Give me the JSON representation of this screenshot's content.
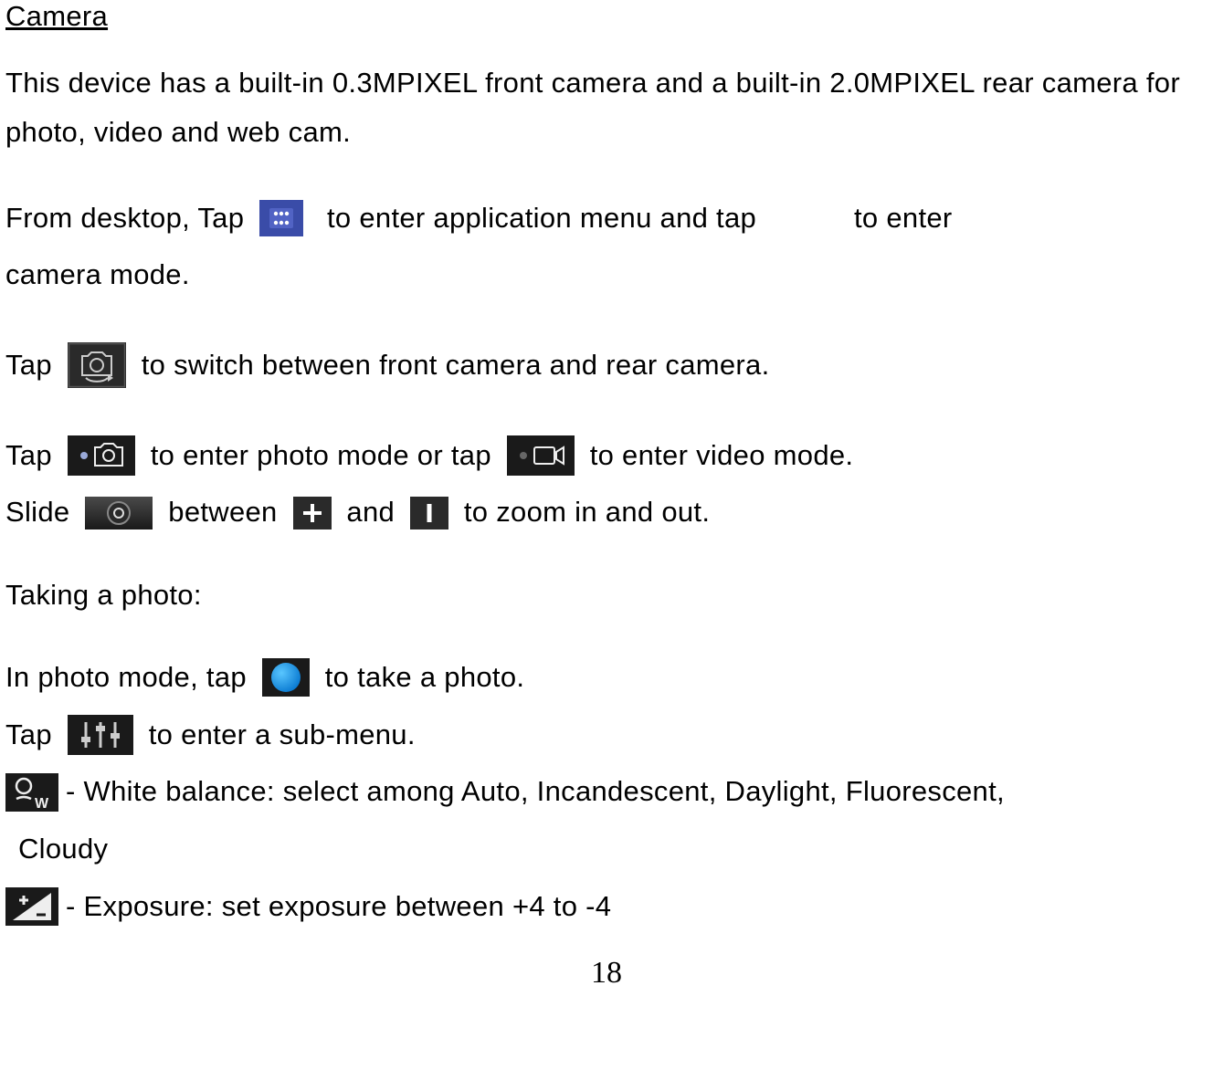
{
  "heading": "Camera",
  "intro": "This device has a built-in 0.3MPIXEL front camera and a built-in 2.0MPIXEL rear camera for photo, video and web cam.",
  "lines": {
    "l1a": "From desktop, Tap ",
    "l1b": "  to enter application menu and tap            to enter ",
    "l1c": "camera mode.",
    "l2a": "Tap ",
    "l2b": " to switch between front camera and rear camera.",
    "l3a": "Tap ",
    "l3b": " to enter photo mode or tap ",
    "l3c": " to enter video mode.",
    "l4a": "Slide ",
    "l4b": " between ",
    "l4c": " and ",
    "l4d": " to zoom in and out.",
    "takingPhoto": "Taking a photo:",
    "l5a": "In photo mode, tap ",
    "l5b": " to take a photo.",
    "l6a": "Tap ",
    "l6b": " to enter a sub-menu.",
    "wb": " - White balance:   select among Auto, Incandescent, Daylight, Fluorescent,",
    "wb2": "Cloudy",
    "exp": " - Exposure:   set exposure between +4 to -4"
  },
  "pageNumber": "18"
}
